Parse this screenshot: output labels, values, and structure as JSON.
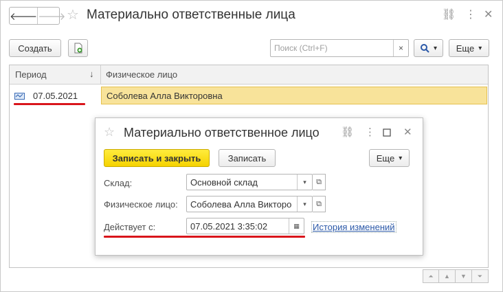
{
  "window": {
    "title": "Материально ответственные лица",
    "nav_back": "🡐",
    "nav_forward": "🡒",
    "star_icon": "☆",
    "link_icon": "⛓",
    "more_icon": "⋮",
    "close_icon": "✕"
  },
  "toolbar": {
    "create_label": "Создать",
    "search_placeholder": "Поиск (Ctrl+F)",
    "search_clear": "×",
    "search_icon": "🔍",
    "more_label": "Еще",
    "dropdown_arrow": "▾"
  },
  "table": {
    "columns": [
      "Период",
      "Физическое лицо"
    ],
    "sort_icon": "↓",
    "rows": [
      {
        "period": "07.05.2021",
        "person": "Соболева Алла Викторовна"
      }
    ]
  },
  "pager": [
    "⏶",
    "▲",
    "▼",
    "⏷"
  ],
  "dialog": {
    "title": "Материально ответственное лицо",
    "save_close_label": "Записать и закрыть",
    "save_label": "Записать",
    "more_label": "Еще",
    "fields": [
      {
        "label": "Склад:",
        "value": "Основной склад"
      },
      {
        "label": "Физическое лицо:",
        "value": "Соболева Алла Викторо"
      },
      {
        "label": "Действует с:",
        "value": "07.05.2021  3:35:02"
      }
    ],
    "history_link": "История изменений",
    "calendar_icon": "▦",
    "open_icon": "⧉"
  },
  "colors": {
    "accent_yellow": "#f5d200",
    "selected_row": "#f8e39a",
    "highlight_red": "#d9151b",
    "link_blue": "#2a58a8"
  }
}
